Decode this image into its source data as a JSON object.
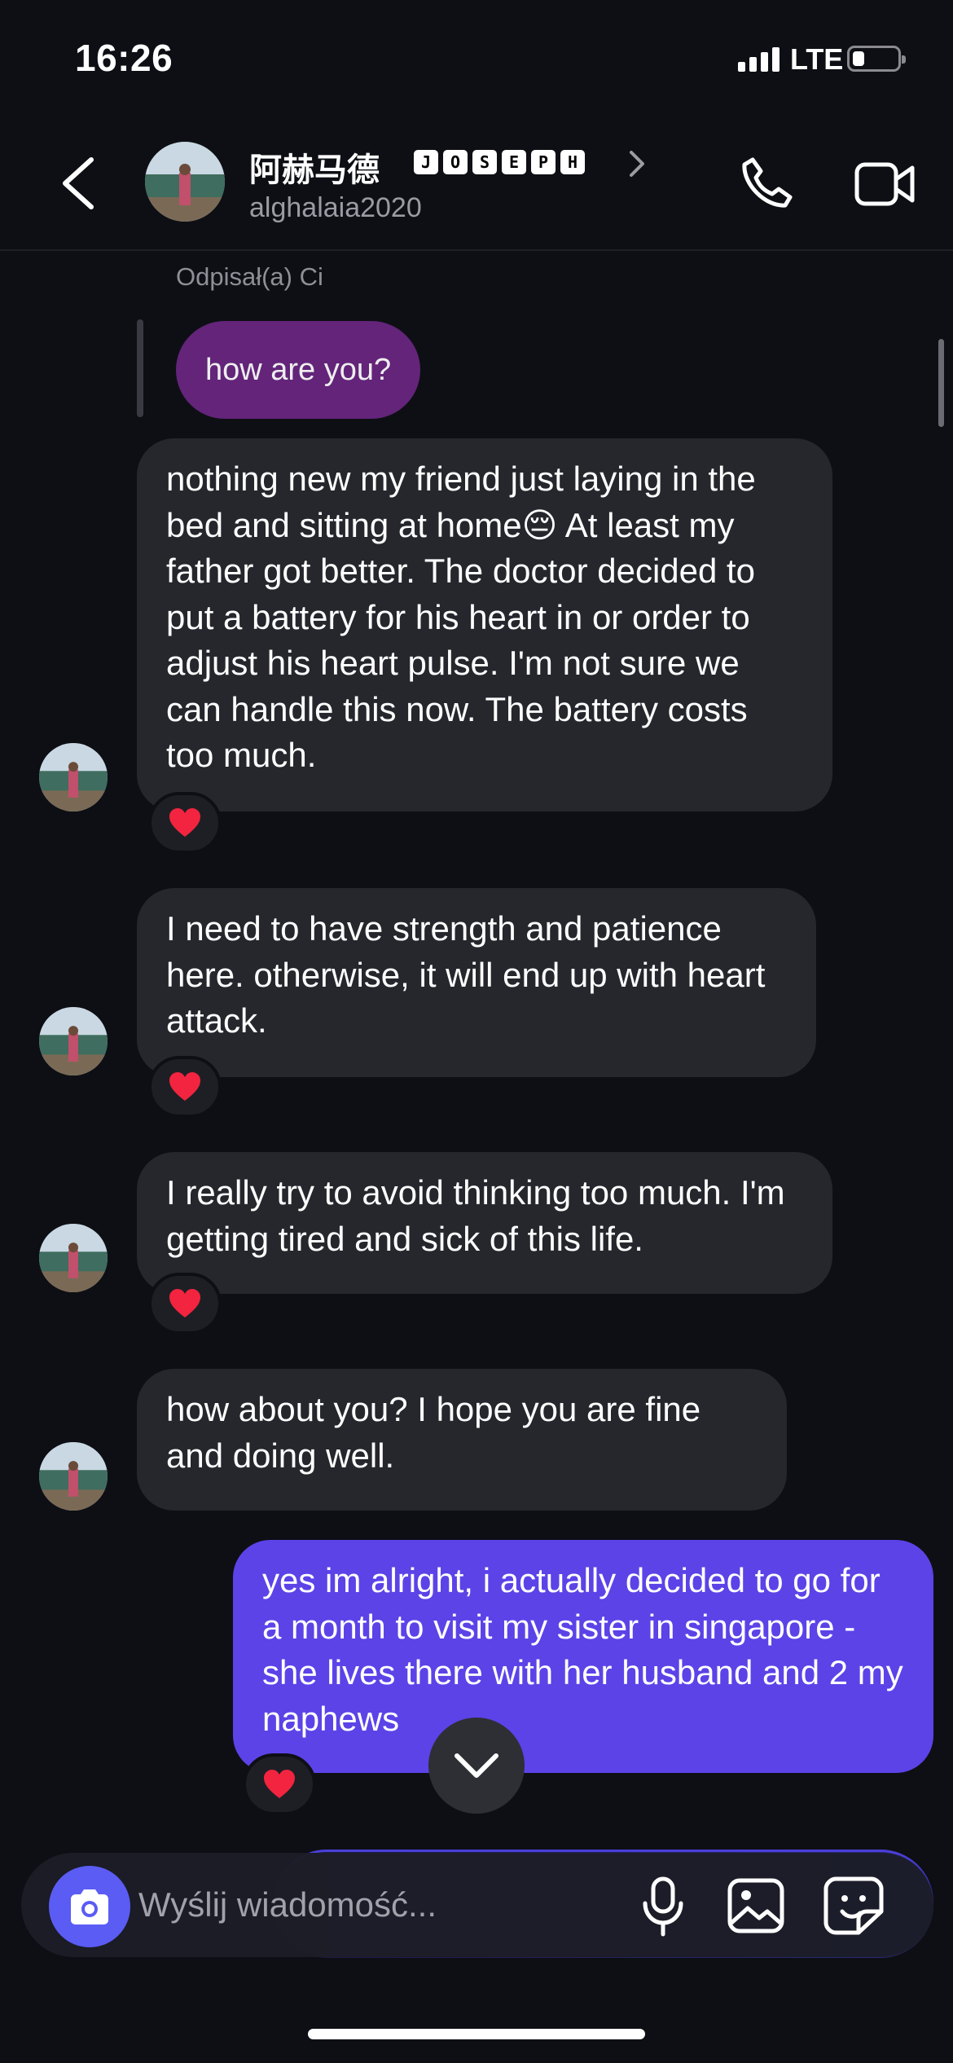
{
  "status": {
    "time": "16:26",
    "network": "LTE",
    "battery_level": 0.25
  },
  "header": {
    "name": "阿赫马德",
    "badge_letters": [
      "J",
      "O",
      "S",
      "E",
      "P",
      "H"
    ],
    "username": "alghalaia2020"
  },
  "thread": {
    "replied_label": "Odpisał(a) Ci",
    "quoted_message": "how are you?",
    "messages": [
      {
        "text": "nothing new my friend just laying in the bed and sitting at home😔 At least my father got better. The doctor decided to put a battery for his heart in or order to adjust his heart pulse. I'm not sure we can handle this now. The battery costs too much.",
        "reaction": "heart"
      },
      {
        "text": "I need to have strength and patience here. otherwise, it will end up with heart attack.",
        "reaction": "heart"
      },
      {
        "text": "I really try to avoid thinking too much. I'm getting tired and sick of this life.",
        "reaction": "heart"
      },
      {
        "text": "how about you? I hope you are fine and doing well.",
        "reaction": ""
      },
      {
        "text": "yes im alright, i actually decided to go for a month to visit my sister in singapore - she lives there with her husband and 2 my naphews",
        "reaction": "heart"
      }
    ]
  },
  "composer": {
    "placeholder": "Wyślij wiadomość..."
  },
  "colors": {
    "incoming": "#26272d",
    "outgoing": "#5b43e8",
    "quoted": "#63247a",
    "background": "#0e0f14"
  }
}
